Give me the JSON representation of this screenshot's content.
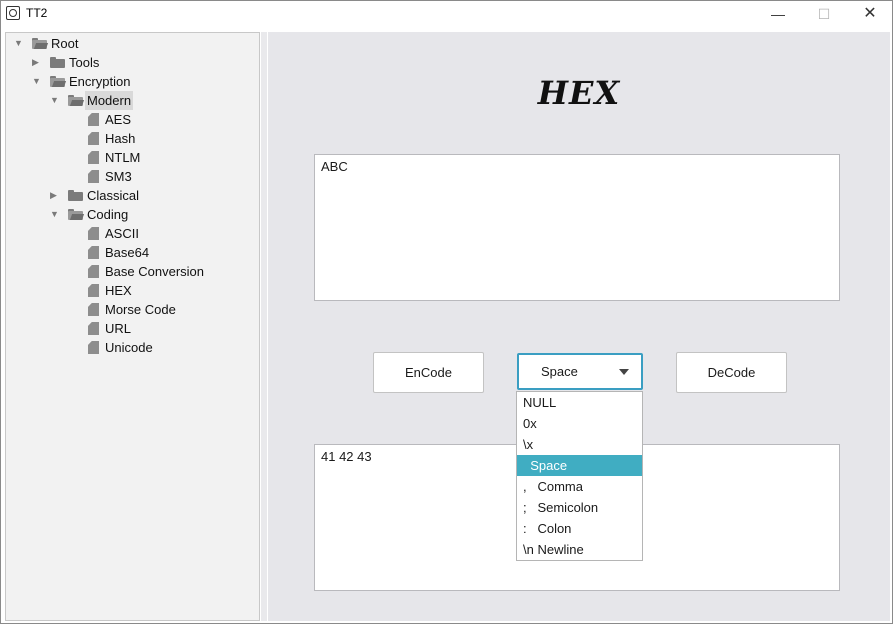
{
  "window": {
    "title": "TT2",
    "minimize": "—",
    "maximize": "☐",
    "close": "✕"
  },
  "tree": {
    "root": "Root",
    "tools": "Tools",
    "encryption": "Encryption",
    "modern": "Modern",
    "modern_items": [
      "AES",
      "Hash",
      "NTLM",
      "SM3"
    ],
    "classical": "Classical",
    "coding": "Coding",
    "coding_items": [
      "ASCII",
      "Base64",
      "Base Conversion",
      "HEX",
      "Morse Code",
      "URL",
      "Unicode"
    ]
  },
  "main": {
    "heading": "HEX",
    "input_text": "ABC",
    "output_text": "41 42 43",
    "encode_label": "EnCode",
    "decode_label": "DeCode",
    "separator_selected": "Space",
    "separator_options": [
      "NULL",
      "0x",
      "\\x",
      "  Space",
      ",   Comma",
      ";   Semicolon",
      ":   Colon",
      "\\n Newline"
    ],
    "highlighted_option_index": 3
  },
  "colors": {
    "accent": "#3a9ec2",
    "highlight": "#40adc2",
    "panel_bg": "#e6e6ea",
    "tree_bg": "#f2f2f2"
  }
}
